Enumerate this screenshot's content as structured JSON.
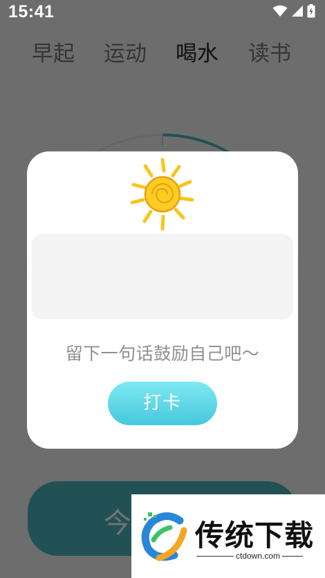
{
  "status_bar": {
    "time": "15:41",
    "icons": [
      "wifi-icon",
      "signal-icon",
      "battery-charging-icon"
    ]
  },
  "tabs": [
    {
      "label": "早起",
      "active": false
    },
    {
      "label": "运动",
      "active": false
    },
    {
      "label": "喝水",
      "active": true
    },
    {
      "label": "读书",
      "active": false
    }
  ],
  "main": {
    "checkin_button_label": "今"
  },
  "dialog": {
    "icon": "sun-icon",
    "message_placeholder": "",
    "message_value": "",
    "hint": "留下一句话鼓励自己吧～",
    "button_label": "打卡"
  },
  "watermark": {
    "title": "传统下载",
    "domain": "ctdown.com"
  },
  "colors": {
    "accent_teal": "#4bb4bd",
    "button_gradient_top": "#7fe9f1",
    "button_gradient_bottom": "#45c8dc",
    "sun_yellow": "#f7c51b",
    "sun_orange": "#f29a12"
  }
}
